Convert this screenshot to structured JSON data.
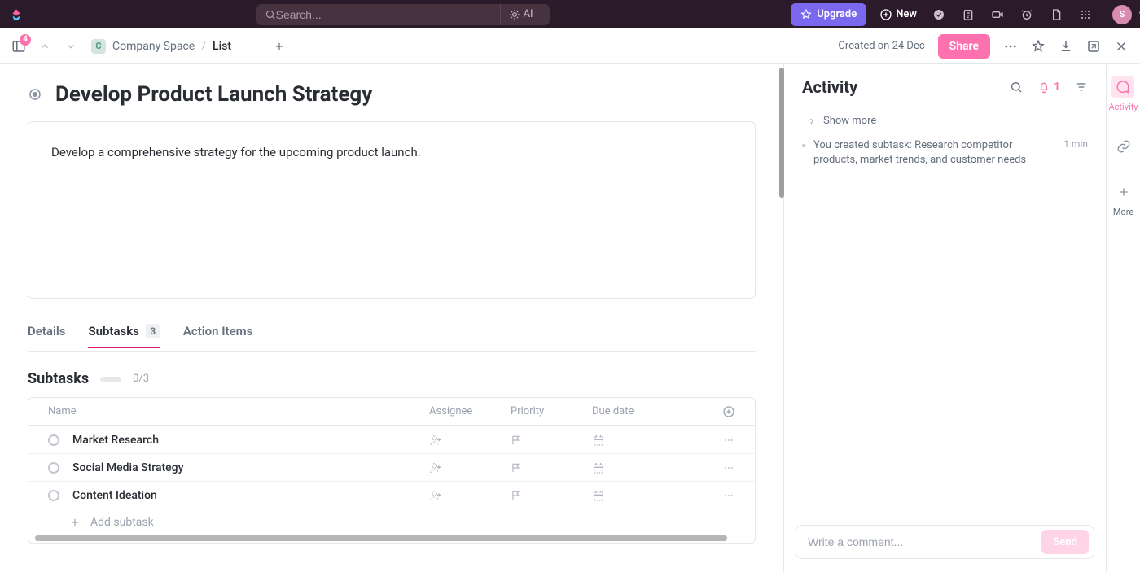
{
  "topbar": {
    "search_placeholder": "Search...",
    "ai_label": "AI",
    "upgrade_label": "Upgrade",
    "new_label": "New",
    "avatar_initial": "S",
    "badge_count": "4"
  },
  "breadcrumb": {
    "space_initial": "C",
    "space_name": "Company Space",
    "list_name": "List"
  },
  "toolbar": {
    "created_on": "Created on 24 Dec",
    "share_label": "Share"
  },
  "task": {
    "title": "Develop Product Launch Strategy",
    "description": "Develop a comprehensive strategy for the upcoming product launch."
  },
  "tabs": {
    "details": "Details",
    "subtasks": "Subtasks",
    "subtasks_count": "3",
    "action_items": "Action Items"
  },
  "subtasks": {
    "heading": "Subtasks",
    "progress_text": "0/3",
    "columns": {
      "name": "Name",
      "assignee": "Assignee",
      "priority": "Priority",
      "due": "Due date"
    },
    "rows": [
      {
        "name": "Market Research"
      },
      {
        "name": "Social Media Strategy"
      },
      {
        "name": "Content Ideation"
      }
    ],
    "add_label": "Add subtask"
  },
  "activity": {
    "title": "Activity",
    "notif_count": "1",
    "show_more": "Show more",
    "items": [
      {
        "text": "You created subtask: Research competitor products, market trends, and customer needs",
        "time": "1 min"
      }
    ],
    "comment_placeholder": "Write a comment...",
    "send_label": "Send"
  },
  "rail": {
    "activity_label": "Activity",
    "more_label": "More"
  }
}
